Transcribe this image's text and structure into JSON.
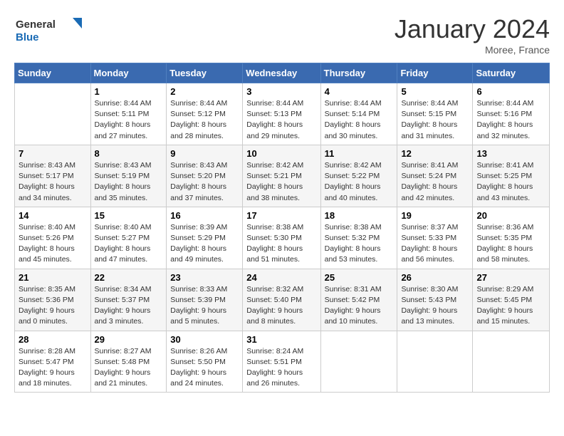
{
  "logo": {
    "line1": "General",
    "line2": "Blue"
  },
  "title": "January 2024",
  "subtitle": "Moree, France",
  "days_header": [
    "Sunday",
    "Monday",
    "Tuesday",
    "Wednesday",
    "Thursday",
    "Friday",
    "Saturday"
  ],
  "weeks": [
    [
      {
        "num": "",
        "sunrise": "",
        "sunset": "",
        "daylight": ""
      },
      {
        "num": "1",
        "sunrise": "Sunrise: 8:44 AM",
        "sunset": "Sunset: 5:11 PM",
        "daylight": "Daylight: 8 hours and 27 minutes."
      },
      {
        "num": "2",
        "sunrise": "Sunrise: 8:44 AM",
        "sunset": "Sunset: 5:12 PM",
        "daylight": "Daylight: 8 hours and 28 minutes."
      },
      {
        "num": "3",
        "sunrise": "Sunrise: 8:44 AM",
        "sunset": "Sunset: 5:13 PM",
        "daylight": "Daylight: 8 hours and 29 minutes."
      },
      {
        "num": "4",
        "sunrise": "Sunrise: 8:44 AM",
        "sunset": "Sunset: 5:14 PM",
        "daylight": "Daylight: 8 hours and 30 minutes."
      },
      {
        "num": "5",
        "sunrise": "Sunrise: 8:44 AM",
        "sunset": "Sunset: 5:15 PM",
        "daylight": "Daylight: 8 hours and 31 minutes."
      },
      {
        "num": "6",
        "sunrise": "Sunrise: 8:44 AM",
        "sunset": "Sunset: 5:16 PM",
        "daylight": "Daylight: 8 hours and 32 minutes."
      }
    ],
    [
      {
        "num": "7",
        "sunrise": "Sunrise: 8:43 AM",
        "sunset": "Sunset: 5:17 PM",
        "daylight": "Daylight: 8 hours and 34 minutes."
      },
      {
        "num": "8",
        "sunrise": "Sunrise: 8:43 AM",
        "sunset": "Sunset: 5:19 PM",
        "daylight": "Daylight: 8 hours and 35 minutes."
      },
      {
        "num": "9",
        "sunrise": "Sunrise: 8:43 AM",
        "sunset": "Sunset: 5:20 PM",
        "daylight": "Daylight: 8 hours and 37 minutes."
      },
      {
        "num": "10",
        "sunrise": "Sunrise: 8:42 AM",
        "sunset": "Sunset: 5:21 PM",
        "daylight": "Daylight: 8 hours and 38 minutes."
      },
      {
        "num": "11",
        "sunrise": "Sunrise: 8:42 AM",
        "sunset": "Sunset: 5:22 PM",
        "daylight": "Daylight: 8 hours and 40 minutes."
      },
      {
        "num": "12",
        "sunrise": "Sunrise: 8:41 AM",
        "sunset": "Sunset: 5:24 PM",
        "daylight": "Daylight: 8 hours and 42 minutes."
      },
      {
        "num": "13",
        "sunrise": "Sunrise: 8:41 AM",
        "sunset": "Sunset: 5:25 PM",
        "daylight": "Daylight: 8 hours and 43 minutes."
      }
    ],
    [
      {
        "num": "14",
        "sunrise": "Sunrise: 8:40 AM",
        "sunset": "Sunset: 5:26 PM",
        "daylight": "Daylight: 8 hours and 45 minutes."
      },
      {
        "num": "15",
        "sunrise": "Sunrise: 8:40 AM",
        "sunset": "Sunset: 5:27 PM",
        "daylight": "Daylight: 8 hours and 47 minutes."
      },
      {
        "num": "16",
        "sunrise": "Sunrise: 8:39 AM",
        "sunset": "Sunset: 5:29 PM",
        "daylight": "Daylight: 8 hours and 49 minutes."
      },
      {
        "num": "17",
        "sunrise": "Sunrise: 8:38 AM",
        "sunset": "Sunset: 5:30 PM",
        "daylight": "Daylight: 8 hours and 51 minutes."
      },
      {
        "num": "18",
        "sunrise": "Sunrise: 8:38 AM",
        "sunset": "Sunset: 5:32 PM",
        "daylight": "Daylight: 8 hours and 53 minutes."
      },
      {
        "num": "19",
        "sunrise": "Sunrise: 8:37 AM",
        "sunset": "Sunset: 5:33 PM",
        "daylight": "Daylight: 8 hours and 56 minutes."
      },
      {
        "num": "20",
        "sunrise": "Sunrise: 8:36 AM",
        "sunset": "Sunset: 5:35 PM",
        "daylight": "Daylight: 8 hours and 58 minutes."
      }
    ],
    [
      {
        "num": "21",
        "sunrise": "Sunrise: 8:35 AM",
        "sunset": "Sunset: 5:36 PM",
        "daylight": "Daylight: 9 hours and 0 minutes."
      },
      {
        "num": "22",
        "sunrise": "Sunrise: 8:34 AM",
        "sunset": "Sunset: 5:37 PM",
        "daylight": "Daylight: 9 hours and 3 minutes."
      },
      {
        "num": "23",
        "sunrise": "Sunrise: 8:33 AM",
        "sunset": "Sunset: 5:39 PM",
        "daylight": "Daylight: 9 hours and 5 minutes."
      },
      {
        "num": "24",
        "sunrise": "Sunrise: 8:32 AM",
        "sunset": "Sunset: 5:40 PM",
        "daylight": "Daylight: 9 hours and 8 minutes."
      },
      {
        "num": "25",
        "sunrise": "Sunrise: 8:31 AM",
        "sunset": "Sunset: 5:42 PM",
        "daylight": "Daylight: 9 hours and 10 minutes."
      },
      {
        "num": "26",
        "sunrise": "Sunrise: 8:30 AM",
        "sunset": "Sunset: 5:43 PM",
        "daylight": "Daylight: 9 hours and 13 minutes."
      },
      {
        "num": "27",
        "sunrise": "Sunrise: 8:29 AM",
        "sunset": "Sunset: 5:45 PM",
        "daylight": "Daylight: 9 hours and 15 minutes."
      }
    ],
    [
      {
        "num": "28",
        "sunrise": "Sunrise: 8:28 AM",
        "sunset": "Sunset: 5:47 PM",
        "daylight": "Daylight: 9 hours and 18 minutes."
      },
      {
        "num": "29",
        "sunrise": "Sunrise: 8:27 AM",
        "sunset": "Sunset: 5:48 PM",
        "daylight": "Daylight: 9 hours and 21 minutes."
      },
      {
        "num": "30",
        "sunrise": "Sunrise: 8:26 AM",
        "sunset": "Sunset: 5:50 PM",
        "daylight": "Daylight: 9 hours and 24 minutes."
      },
      {
        "num": "31",
        "sunrise": "Sunrise: 8:24 AM",
        "sunset": "Sunset: 5:51 PM",
        "daylight": "Daylight: 9 hours and 26 minutes."
      },
      {
        "num": "",
        "sunrise": "",
        "sunset": "",
        "daylight": ""
      },
      {
        "num": "",
        "sunrise": "",
        "sunset": "",
        "daylight": ""
      },
      {
        "num": "",
        "sunrise": "",
        "sunset": "",
        "daylight": ""
      }
    ]
  ]
}
